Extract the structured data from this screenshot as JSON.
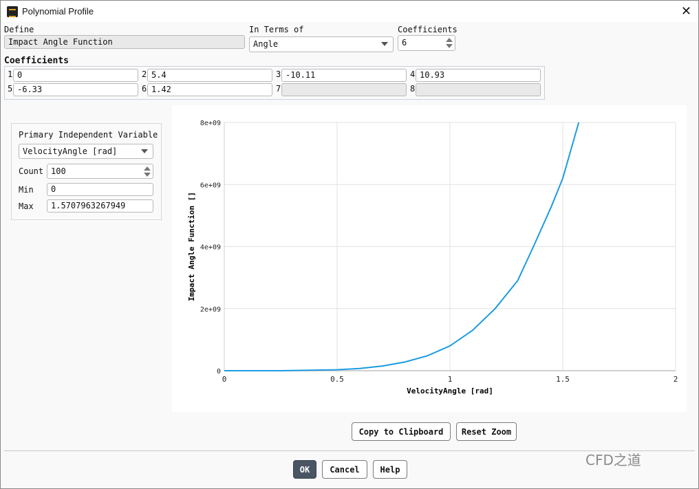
{
  "window": {
    "title": "Polynomial Profile"
  },
  "define": {
    "label": "Define",
    "value": "Impact Angle Function"
  },
  "in_terms_of": {
    "label": "In Terms of",
    "value": "Angle"
  },
  "coeff_count": {
    "label": "Coefficients",
    "value": "6"
  },
  "coefficients": {
    "label": "Coefficients",
    "items": [
      {
        "n": "1",
        "v": "0"
      },
      {
        "n": "2",
        "v": "5.4"
      },
      {
        "n": "3",
        "v": "-10.11"
      },
      {
        "n": "4",
        "v": "10.93"
      },
      {
        "n": "5",
        "v": "-6.33"
      },
      {
        "n": "6",
        "v": "1.42"
      },
      {
        "n": "7",
        "v": ""
      },
      {
        "n": "8",
        "v": ""
      }
    ]
  },
  "panel": {
    "title": "Primary Independent Variable",
    "variable": "VelocityAngle [rad]",
    "count_label": "Count",
    "count": "100",
    "min_label": "Min",
    "min": "0",
    "max_label": "Max",
    "max": "1.5707963267949"
  },
  "chart_data": {
    "type": "line",
    "xlabel": "VelocityAngle [rad]",
    "ylabel": "Impact Angle Function []",
    "xlim": [
      0,
      2
    ],
    "ylim": [
      0,
      8000000000
    ],
    "xticks": [
      "0",
      "0.5",
      "1",
      "1.5",
      "2"
    ],
    "yticks": [
      "0",
      "2e+09",
      "4e+09",
      "6e+09",
      "8e+09"
    ],
    "grid": true,
    "color": "#1a9be0",
    "x": [
      0,
      0.25,
      0.5,
      0.6,
      0.7,
      0.8,
      0.9,
      1.0,
      1.1,
      1.2,
      1.3,
      1.37,
      1.45,
      1.5,
      1.5708
    ],
    "y": [
      0,
      1000000,
      30000000,
      70000000,
      150000000,
      280000000,
      480000000,
      800000000,
      1300000000,
      2000000000,
      2900000000,
      4000000000,
      5300000000,
      6200000000,
      8000000000
    ]
  },
  "buttons": {
    "copy": "Copy to Clipboard",
    "reset": "Reset Zoom",
    "ok": "OK",
    "cancel": "Cancel",
    "help": "Help"
  },
  "watermark": "CFD之道"
}
